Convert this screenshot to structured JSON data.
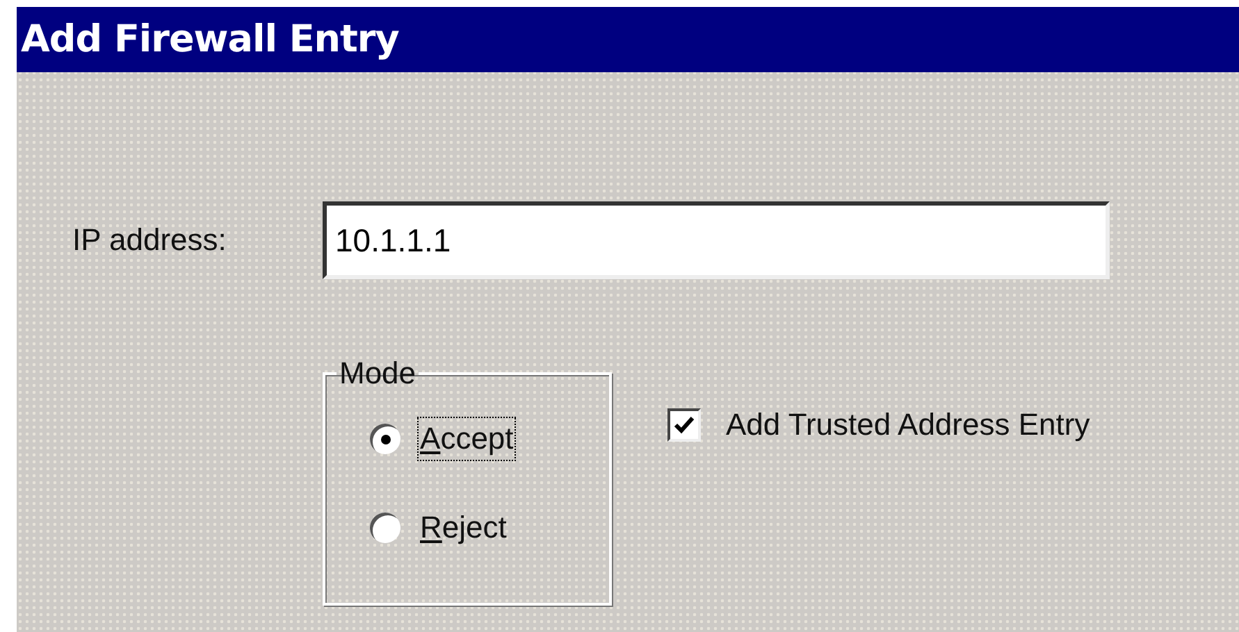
{
  "window": {
    "title": "Add Firewall Entry"
  },
  "ip_address": {
    "label": "IP address:",
    "value": "10.1.1.1"
  },
  "mode": {
    "legend": "Mode",
    "options": [
      {
        "label": "Accept",
        "selected": true,
        "focused": true,
        "mnemonic_underlined": true
      },
      {
        "label": "Reject",
        "selected": false,
        "focused": false,
        "mnemonic_underlined": true
      }
    ]
  },
  "trusted": {
    "label": "Add Trusted Address Entry",
    "checked": true
  }
}
